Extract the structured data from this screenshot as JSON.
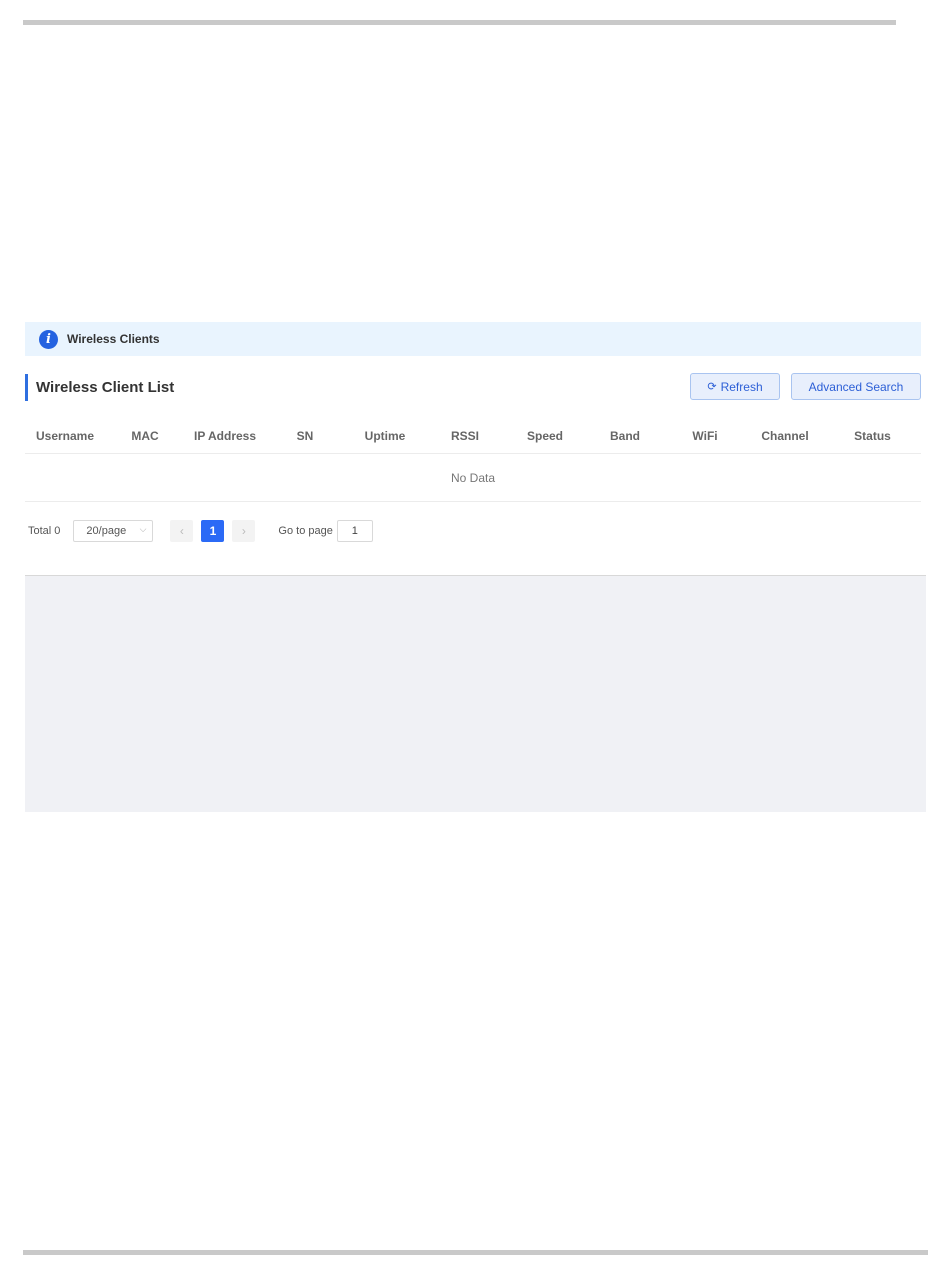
{
  "banner": {
    "icon": "info-icon",
    "text": "Wireless Clients"
  },
  "section": {
    "title": "Wireless Client List"
  },
  "toolbar": {
    "refresh_icon": "refresh-icon",
    "refresh_label": "Refresh",
    "advanced_search_label": "Advanced Search"
  },
  "table": {
    "columns": [
      "Username",
      "MAC",
      "IP Address",
      "SN",
      "Uptime",
      "RSSI",
      "Speed",
      "Band",
      "WiFi",
      "Channel",
      "Status"
    ],
    "empty_text": "No Data"
  },
  "pagination": {
    "total_label": "Total 0",
    "page_size": "20/page",
    "current_page": "1",
    "goto_label": "Go to page",
    "goto_value": "1"
  },
  "colors": {
    "accent": "#2b6af6",
    "banner_bg": "#e9f4fe",
    "panel_bg": "#f0f1f5"
  }
}
